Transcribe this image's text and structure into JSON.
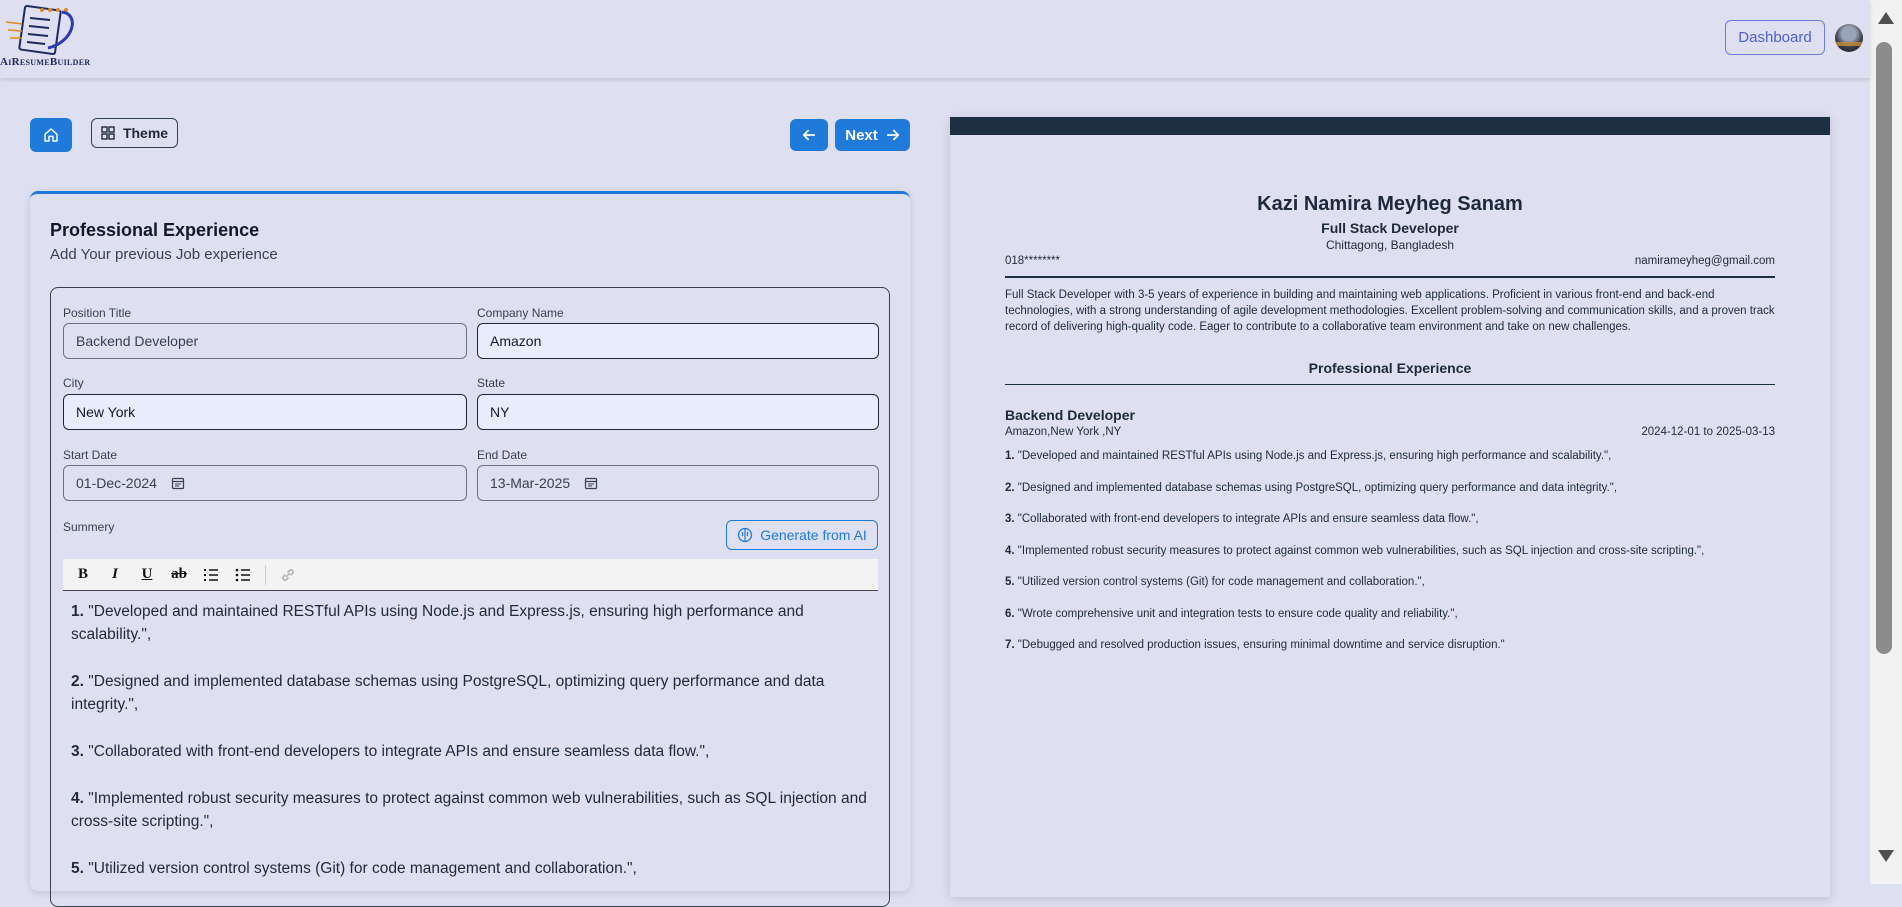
{
  "brand": {
    "logo_text": "AiResumeBuilder"
  },
  "header": {
    "dashboard_label": "Dashboard"
  },
  "nav": {
    "theme_label": "Theme",
    "next_label": "Next"
  },
  "form": {
    "title": "Professional Experience",
    "subtitle": "Add Your previous Job experience",
    "position_title_label": "Position Title",
    "position_title_value": "Backend Developer",
    "company_label": "Company Name",
    "company_value": "Amazon",
    "city_label": "City",
    "city_value": "New York",
    "state_label": "State",
    "state_value": "NY",
    "start_label": "Start Date",
    "start_value": "01-Dec-2024",
    "end_label": "End Date",
    "end_value": "13-Mar-2025",
    "summary_label": "Summery",
    "generate_label": "Generate from AI",
    "items": [
      {
        "num": "1.",
        "text": " \"Developed and maintained RESTful APIs using Node.js and Express.js, ensuring high performance and scalability.\","
      },
      {
        "num": "2.",
        "text": "  \"Designed and implemented database schemas using PostgreSQL, optimizing query performance and data integrity.\","
      },
      {
        "num": "3.",
        "text": "  \"Collaborated with front-end developers to integrate APIs and ensure seamless data flow.\","
      },
      {
        "num": "4.",
        "text": " \"Implemented robust security measures to protect against common web vulnerabilities, such as SQL injection and cross-site scripting.\","
      },
      {
        "num": "5.",
        "text": " \"Utilized version control systems (Git) for code management and collaboration.\","
      }
    ]
  },
  "preview": {
    "name": "Kazi Namira Meyheg Sanam",
    "title": "Full Stack Developer",
    "location": "Chittagong, Bangladesh",
    "phone": "018********",
    "email": "namirameyheg@gmail.com",
    "summary": "Full Stack Developer with 3-5 years of experience in building and maintaining web applications. Proficient in various front-end and back-end technologies, with a strong understanding of agile development methodologies. Excellent problem-solving and communication skills, and a proven track record of delivering high-quality code. Eager to contribute to a collaborative team environment and take on new challenges.",
    "section_title": "Professional Experience",
    "position": "Backend Developer",
    "company_line": "Amazon,New York ,NY",
    "dates": "2024-12-01 to 2025-03-13",
    "items": [
      {
        "num": "1.",
        "text": " \"Developed and maintained RESTful APIs using Node.js and Express.js, ensuring high performance and scalability.\","
      },
      {
        "num": "2.",
        "text": "  \"Designed and implemented database schemas using PostgreSQL, optimizing query performance and data integrity.\","
      },
      {
        "num": "3.",
        "text": "  \"Collaborated with front-end developers to integrate APIs and ensure seamless data flow.\","
      },
      {
        "num": "4.",
        "text": " \"Implemented robust security measures to protect against common web vulnerabilities, such as SQL injection and cross-site scripting.\","
      },
      {
        "num": "5.",
        "text": " \"Utilized version control systems (Git) for code management and collaboration.\","
      },
      {
        "num": "6.",
        "text": " \"Wrote comprehensive unit and integration tests to ensure code quality and reliability.\","
      },
      {
        "num": "7.",
        "text": " \"Debugged and resolved production issues, ensuring minimal downtime and service disruption.\""
      }
    ]
  },
  "colors": {
    "accent": "#1f7ad9",
    "background": "#dedff1",
    "preview_header": "#1e2f42"
  }
}
